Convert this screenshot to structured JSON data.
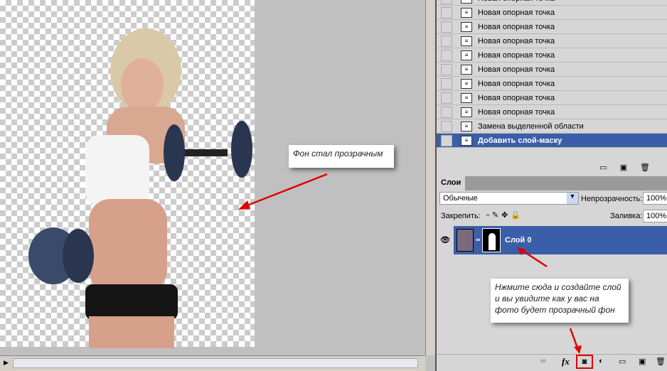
{
  "canvas": {
    "note": "Фон стал прозрачным"
  },
  "history": {
    "items": [
      "Новая опорная точка",
      "Новая опорная точка",
      "Новая опорная точка",
      "Новая опорная точка",
      "Новая опорная точка",
      "Новая опорная точка",
      "Новая опорная точка",
      "Новая опорная точка",
      "Новая опорная точка",
      "Замена выделенной области",
      "Добавить слой-маску"
    ],
    "selected": 10
  },
  "layers": {
    "tab": "Слои",
    "blend_mode": "Обычные",
    "opacity_label": "Непрозрачность:",
    "opacity": "100%",
    "lock_label": "Закрепить:",
    "fill_label": "Заливка:",
    "fill": "100%",
    "layer_name": "Слой 0",
    "note": "Нжмите сюда и создайте слой и вы увидите как у вас на фото будет прозрачный фон",
    "fx_label": "fx"
  },
  "colors": {
    "selection": "#3a5ea8",
    "arrow": "#e00000"
  }
}
